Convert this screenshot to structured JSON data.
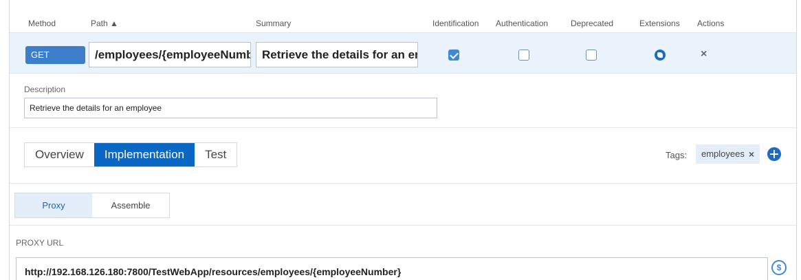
{
  "header": {
    "method": "Method",
    "path": "Path ▲",
    "summary": "Summary",
    "identification": "Identification",
    "authentication": "Authentication",
    "deprecated": "Deprecated",
    "extensions": "Extensions",
    "actions": "Actions"
  },
  "row": {
    "method": "GET",
    "path_value": "/employees/{employeeNumber}",
    "summary_value": "Retrieve the details for an employee",
    "identification_checked": true,
    "authentication_checked": false,
    "deprecated_checked": false,
    "extensions_icon": "puzzle-icon",
    "remove_icon": "×"
  },
  "description": {
    "label": "Description",
    "value": "Retrieve the details for an employee"
  },
  "tabs": [
    {
      "label": "Overview",
      "active": false
    },
    {
      "label": "Implementation",
      "active": true
    },
    {
      "label": "Test",
      "active": false
    }
  ],
  "tags": {
    "label": "Tags:",
    "items": [
      "employees"
    ],
    "remove_icon": "×",
    "add_icon": "plus-circle-icon"
  },
  "subtabs": [
    {
      "label": "Proxy",
      "active": true
    },
    {
      "label": "Assemble",
      "active": false
    }
  ],
  "proxy": {
    "label": "PROXY URL",
    "value": "http://192.168.126.180:7800/TestWebApp/resources/employees/{employeeNumber}",
    "icon_text": "$"
  },
  "colors": {
    "accent": "#0b67c4",
    "row_bg": "#eaf3fb",
    "method_badge": "#3d7ecb"
  }
}
